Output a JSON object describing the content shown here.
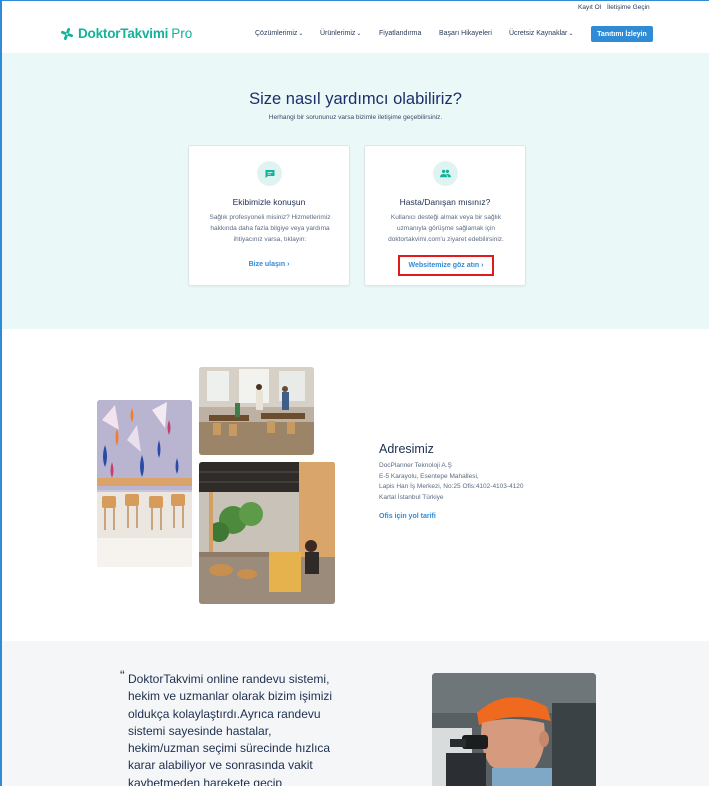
{
  "topbar": {
    "register": "Kayıt Ol",
    "contact": "İletişime Geçin"
  },
  "brand": {
    "name": "DoktorTakvimi",
    "suffix": "Pro",
    "color": "#13b29a"
  },
  "nav": {
    "items": [
      {
        "label": "Çözümlerimiz",
        "has_dropdown": true
      },
      {
        "label": "Ürünlerimiz",
        "has_dropdown": true
      },
      {
        "label": "Fiyatlandırma",
        "has_dropdown": false
      },
      {
        "label": "Başarı Hikayeleri",
        "has_dropdown": false
      },
      {
        "label": "Ücretsiz Kaynaklar",
        "has_dropdown": true
      }
    ],
    "cta": "Tanıtımı İzleyin"
  },
  "help": {
    "title": "Size nasıl yardımcı olabiliriz?",
    "subtitle": "Herhangi bir sorununuz varsa bizimle iletişime geçebilirsiniz.",
    "cards": [
      {
        "icon": "chat-bubble-icon",
        "title": "Ekibimizle konuşun",
        "desc_lines": [
          "Sağlık profesyoneli misiniz? Hizmetlerimiz",
          "hakkında daha fazla bilgiye veya yardıma",
          "ihtiyacınız varsa, tıklayın:"
        ],
        "link": "Bize ulaşın"
      },
      {
        "icon": "people-icon",
        "title": "Hasta/Danışan mısınız?",
        "desc_lines": [
          "Kullanıcı desteği almak veya bir sağlık",
          "uzmanıyla görüşme sağlamak için",
          "doktortakvimi.com'u ziyaret edebilirsiniz."
        ],
        "link": "Websitemize göz atın"
      }
    ]
  },
  "address": {
    "title": "Adresimiz",
    "lines": [
      "DocPlanner Teknoloji A.Ş",
      "E-5 Karayolu, Esentepe Mahallesi,",
      "Lapis Han İş Merkezi, No:25 Ofis:4102-4103-4120",
      "Kartal İstanbul Türkiye"
    ],
    "link": "Ofis için yol tarifi"
  },
  "testimonial": {
    "quote_mark": "“",
    "lines": [
      "DoktorTakvimi online randevu sistemi,",
      "hekim ve uzmanlar olarak bizim işimizi",
      "oldukça kolaylaştırdı.Ayrıca randevu",
      "sistemi sayesinde hastalar,",
      "hekim/uzman seçimi sürecinde hızlıca",
      "karar alabiliyor ve sonrasında vakit",
      "kaybetmeden harekete geçip"
    ]
  },
  "colors": {
    "accent": "#2f8bd6",
    "mint_bg": "#eaf8f7",
    "highlight": "#e01b1b",
    "navy": "#1d2f6a"
  }
}
